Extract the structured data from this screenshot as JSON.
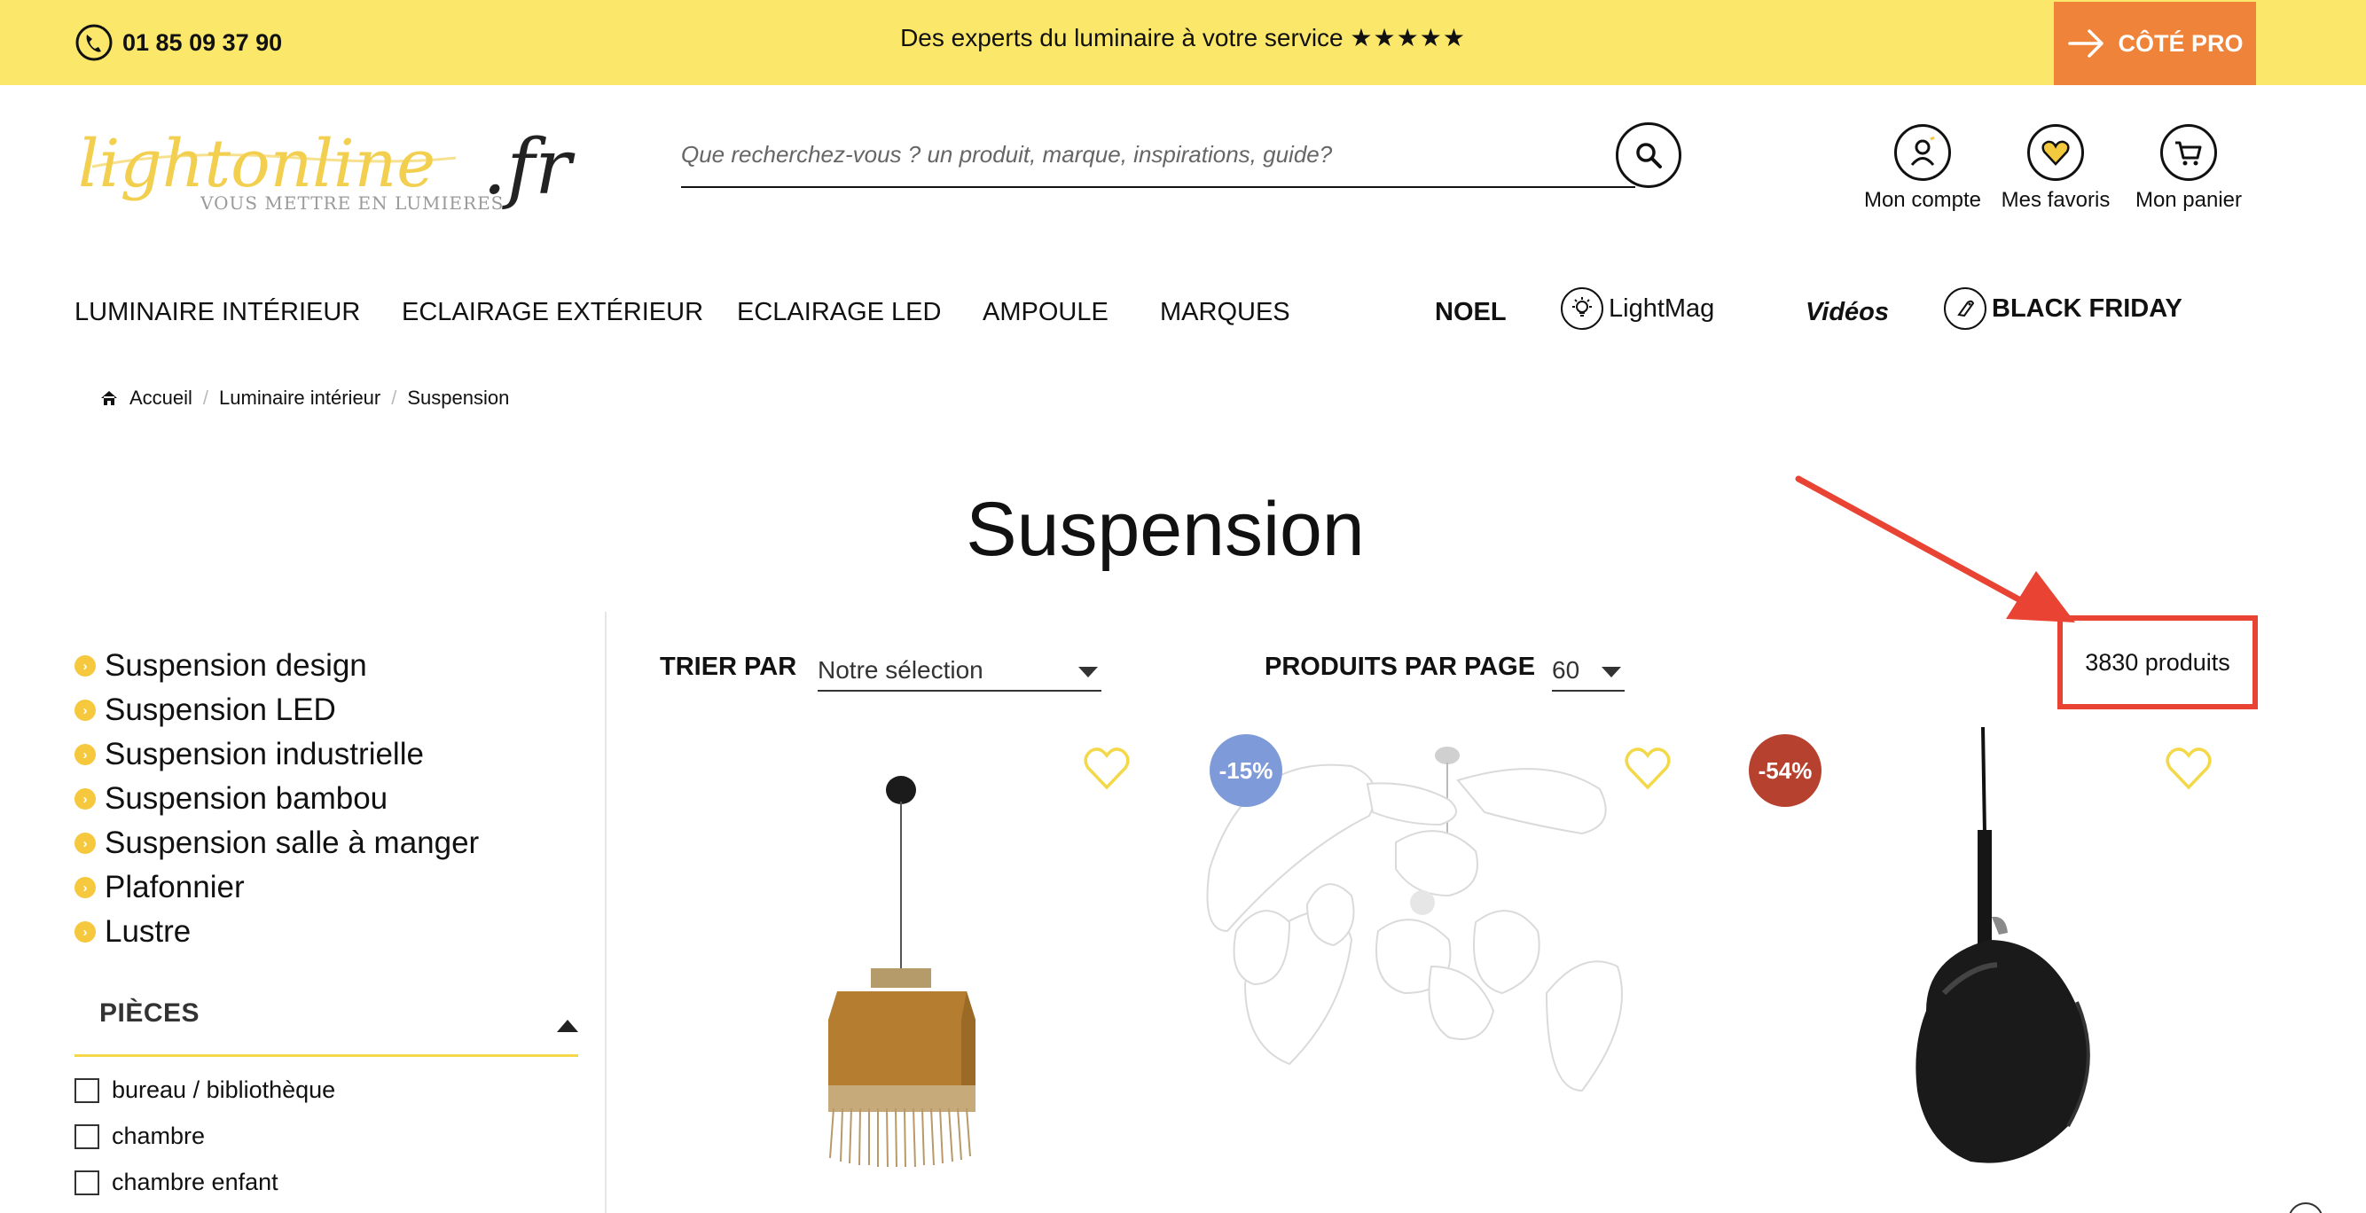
{
  "topbar": {
    "phone": "01 85 09 37 90",
    "tagline": "Des experts du luminaire à votre service",
    "stars": "★★★★★",
    "pro_button": "CÔTÉ PRO"
  },
  "header": {
    "logo_text": "lightonline",
    "logo_suffix": ".fr",
    "logo_tagline": "VOUS METTRE EN LUMIERES",
    "search_placeholder": "Que recherchez-vous ? un produit, marque, inspirations, guide?",
    "account": "Mon compte",
    "favorites": "Mes favoris",
    "cart": "Mon panier"
  },
  "nav": {
    "items": [
      "LUMINAIRE INTÉRIEUR",
      "ECLAIRAGE EXTÉRIEUR",
      "ECLAIRAGE LED",
      "AMPOULE",
      "MARQUES",
      "NOEL",
      "LightMag",
      "Vidéos",
      "BLACK FRIDAY"
    ]
  },
  "breadcrumb": {
    "items": [
      "Accueil",
      "Luminaire intérieur",
      "Suspension"
    ],
    "separator": "/"
  },
  "page": {
    "title": "Suspension",
    "product_count": "3830 produits"
  },
  "sidebar": {
    "categories": [
      "Suspension design",
      "Suspension LED",
      "Suspension industrielle",
      "Suspension bambou",
      "Suspension salle à manger",
      "Plafonnier",
      "Lustre"
    ],
    "filter_title": "PIÈCES",
    "filter_options": [
      "bureau / bibliothèque",
      "chambre",
      "chambre enfant"
    ]
  },
  "toolbar": {
    "sort_label": "TRIER PAR",
    "sort_value": "Notre sélection",
    "per_page_label": "PRODUITS PAR PAGE",
    "per_page_value": "60"
  },
  "products": [
    {
      "badge": ""
    },
    {
      "badge": "-15%",
      "badge_color": "#7f9ad8"
    },
    {
      "badge": "-54%",
      "badge_color": "#b7412f"
    }
  ],
  "colors": {
    "topbar": "#fbe86b",
    "pro_button": "#ef833a",
    "annotation": "#e94334",
    "favorite_heart": "#f3d94a"
  }
}
